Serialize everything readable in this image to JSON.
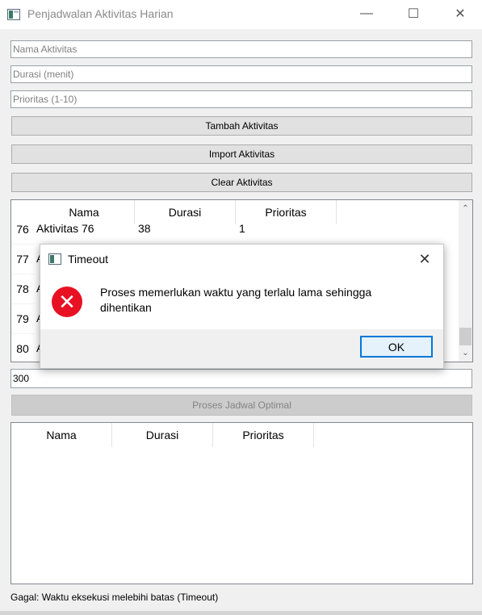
{
  "window": {
    "title": "Penjadwalan Aktivitas Harian",
    "minimize_glyph": "—",
    "maximize_glyph": "☐",
    "close_glyph": "✕"
  },
  "form": {
    "name_placeholder": "Nama Aktivitas",
    "duration_placeholder": "Durasi (menit)",
    "priority_placeholder": "Prioritas (1-10)",
    "add_label": "Tambah Aktivitas",
    "import_label": "Import Aktivitas",
    "clear_label": "Clear Aktivitas"
  },
  "activity_table": {
    "headers": [
      "Nama",
      "Durasi",
      "Prioritas"
    ],
    "rows": [
      {
        "num": "76",
        "name": "Aktivitas 76",
        "duration": "38",
        "priority": "1"
      },
      {
        "num": "77",
        "name": "A",
        "duration": "",
        "priority": ""
      },
      {
        "num": "78",
        "name": "A",
        "duration": "",
        "priority": ""
      },
      {
        "num": "79",
        "name": "A",
        "duration": "",
        "priority": ""
      },
      {
        "num": "80",
        "name": "A",
        "duration": "",
        "priority": ""
      }
    ],
    "scroll_up_glyph": "⌃",
    "scroll_down_glyph": "⌄"
  },
  "time_limit": {
    "value": "300"
  },
  "process_label": "Proses Jadwal Optimal",
  "result_table": {
    "headers": [
      "Nama",
      "Durasi",
      "Prioritas"
    ]
  },
  "status_text": "Gagal: Waktu eksekusi melebihi batas (Timeout)",
  "dialog": {
    "title": "Timeout",
    "message": "Proses memerlukan waktu yang terlalu lama sehingga dihentikan",
    "ok_label": "OK",
    "close_glyph": "✕",
    "error_glyph": "✕"
  },
  "colors": {
    "error_red": "#e81123",
    "ok_border": "#0078d7"
  }
}
